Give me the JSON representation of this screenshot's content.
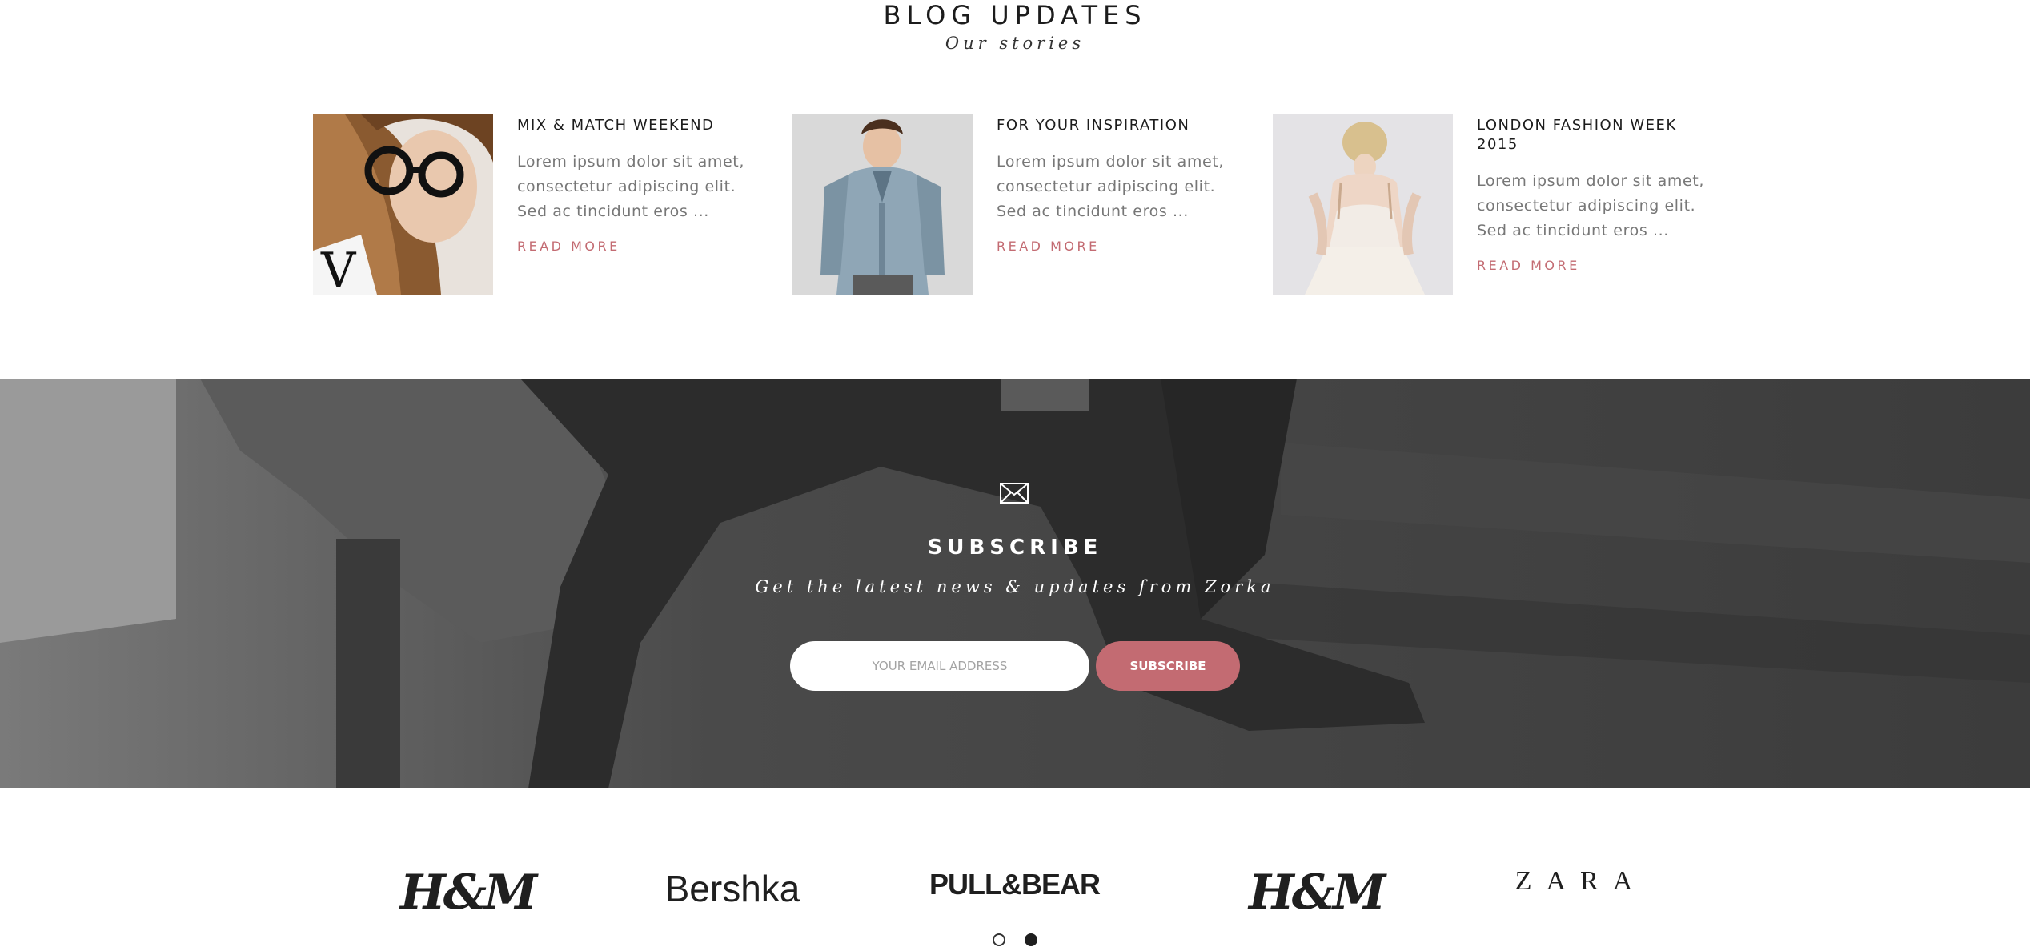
{
  "blog": {
    "title": "BLOG UPDATES",
    "subtitle": "Our stories",
    "posts": [
      {
        "title": "MIX & MATCH WEEKEND",
        "excerpt": "Lorem ipsum dolor sit amet, consectetur adipiscing elit. Sed ac tincidunt eros ...",
        "read_more": "READ MORE"
      },
      {
        "title": "FOR YOUR INSPIRATION",
        "excerpt": "Lorem ipsum dolor sit amet, consectetur adipiscing elit. Sed ac tincidunt eros ...",
        "read_more": "READ MORE"
      },
      {
        "title": "LONDON FASHION WEEK 2015",
        "excerpt": "Lorem ipsum dolor sit amet, consectetur adipiscing elit. Sed ac tincidunt eros ...",
        "read_more": "READ MORE"
      }
    ]
  },
  "subscribe": {
    "icon": "envelope-icon",
    "title": "SUBSCRIBE",
    "tagline": "Get the latest news & updates from Zorka",
    "email_placeholder": "YOUR EMAIL ADDRESS",
    "button_label": "SUBSCRIBE"
  },
  "brands": [
    "H&M",
    "Bershka",
    "PULL&BEAR",
    "H&M",
    "ZARA"
  ],
  "carousel": {
    "pages": 2,
    "active_page": 2
  },
  "colors": {
    "accent": "#c36b72",
    "text_dark": "#1c1c1c",
    "text_muted": "#777777"
  }
}
